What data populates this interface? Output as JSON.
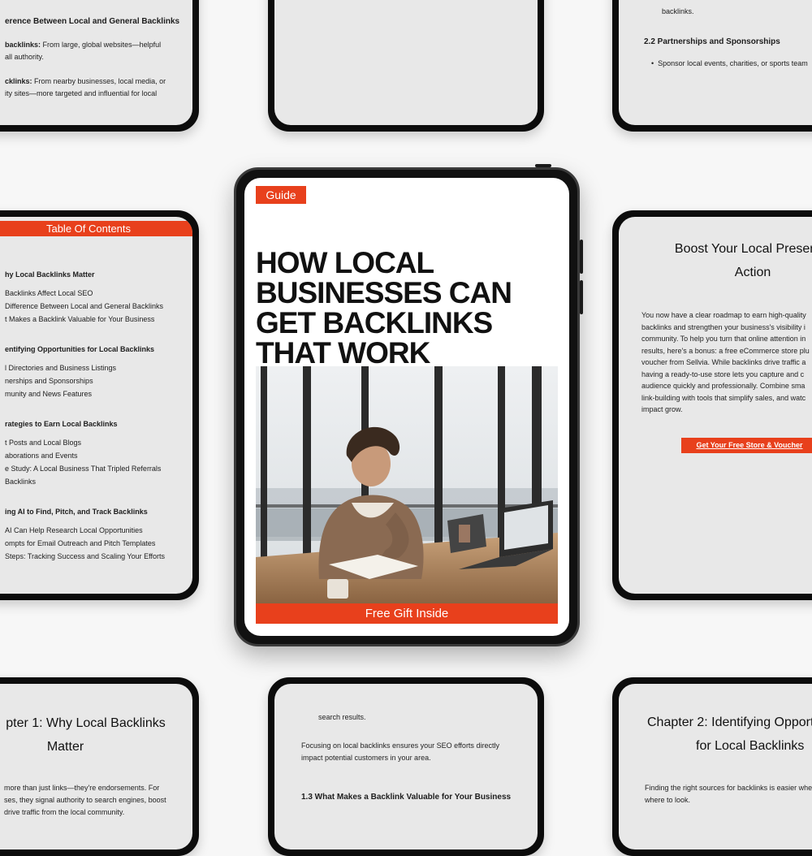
{
  "top_left_page": {
    "heading": "erence Between Local and General Backlinks",
    "p1_bold": "backlinks:",
    "p1_rest": " From large, global websites—helpful",
    "p1_line2": "all authority.",
    "p2_bold": "cklinks:",
    "p2_rest": " From nearby businesses, local media, or",
    "p2_line2": "ity sites—more targeted and influential for local"
  },
  "top_right_page": {
    "line_top": "backlinks.",
    "section": "2.2 Partnerships and Sponsorships",
    "bullet": "Sponsor local events, charities, or sports team"
  },
  "toc_page": {
    "header": "Table Of Contents",
    "groups": [
      {
        "title": "hy Local Backlinks Matter",
        "items": [
          "Backlinks Affect Local SEO",
          "Difference Between Local and General Backlinks",
          "t Makes a Backlink Valuable for Your Business"
        ]
      },
      {
        "title": "entifying Opportunities for Local Backlinks",
        "items": [
          "l Directories and Business Listings",
          "nerships and Sponsorships",
          "munity and News Features"
        ]
      },
      {
        "title": "rategies to Earn Local Backlinks",
        "items": [
          "t Posts and Local Blogs",
          "aborations and Events",
          "e Study: A Local Business That Tripled Referrals",
          "Backlinks"
        ]
      },
      {
        "title": "ing AI to Find, Pitch, and Track Backlinks",
        "items": [
          "AI Can Help Research Local Opportunities",
          "ompts for Email Outreach and Pitch Templates",
          "Steps: Tracking Success and Scaling Your Efforts"
        ]
      }
    ]
  },
  "cover": {
    "badge": "Guide",
    "title_lines": [
      "HOW LOCAL",
      "BUSINESSES CAN",
      "GET BACKLINKS",
      "THAT WORK"
    ],
    "footer": "Free Gift Inside"
  },
  "right_page": {
    "heading_line1": "Boost Your Local Presence",
    "heading_line2": "Action",
    "body": [
      "You now have a clear roadmap to earn high-quality",
      "backlinks and strengthen your business's visibility i",
      "community. To help you turn that online attention in",
      "results, here's a bonus: a free eCommerce store plu",
      "voucher from Sellvia. While backlinks drive traffic a",
      "having a ready-to-use store lets you capture and c",
      "audience quickly and professionally. Combine sma",
      "link-building with tools that simplify sales, and watc",
      "impact grow."
    ],
    "button": "Get Your Free Store & Voucher"
  },
  "bottom_left_page": {
    "heading_line1": "pter 1: Why Local Backlinks",
    "heading_line2": "Matter",
    "body": [
      "more than just links—they're endorsements. For",
      "ses, they signal authority to search engines, boost",
      "drive traffic from the local community."
    ]
  },
  "bottom_center_page": {
    "line1": "search results.",
    "para_lines": [
      "Focusing on local backlinks ensures your SEO efforts directly",
      "impact potential customers in your area."
    ],
    "section": "1.3 What Makes a Backlink Valuable for Your Business"
  },
  "bottom_right_page": {
    "heading_line1": "Chapter 2: Identifying Opport",
    "heading_line2": "for Local Backlinks",
    "body": [
      "Finding the right sources for backlinks is easier whe",
      "where to look."
    ]
  },
  "colors": {
    "accent": "#e8401c",
    "page_bg": "#e8e8e8",
    "device": "#0c0c0c"
  }
}
